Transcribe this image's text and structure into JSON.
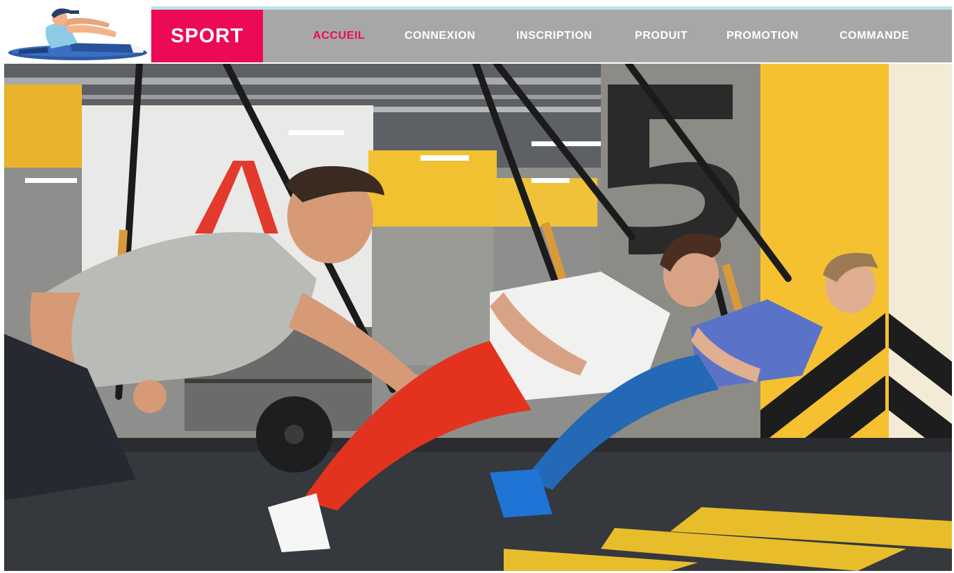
{
  "header": {
    "logo_icon": "stretching-athlete-logo",
    "brand": "SPORT",
    "brand_color": "#ec0a55"
  },
  "nav": {
    "active_color": "#ec0a55",
    "inactive_color": "#ffffff",
    "items": [
      {
        "label": "ACCUEIL",
        "active": true
      },
      {
        "label": "CONNEXION",
        "active": false
      },
      {
        "label": "INSCRIPTION",
        "active": false
      },
      {
        "label": "PRODUIT",
        "active": false
      },
      {
        "label": "PROMOTION",
        "active": false
      },
      {
        "label": "COMMANDE",
        "active": false
      }
    ]
  },
  "hero": {
    "image": "gym-suspension-training-photo",
    "colors": {
      "wall_yellow": "#f5c131",
      "floor": "#35383c",
      "stripe": "#e8bd2c"
    }
  }
}
